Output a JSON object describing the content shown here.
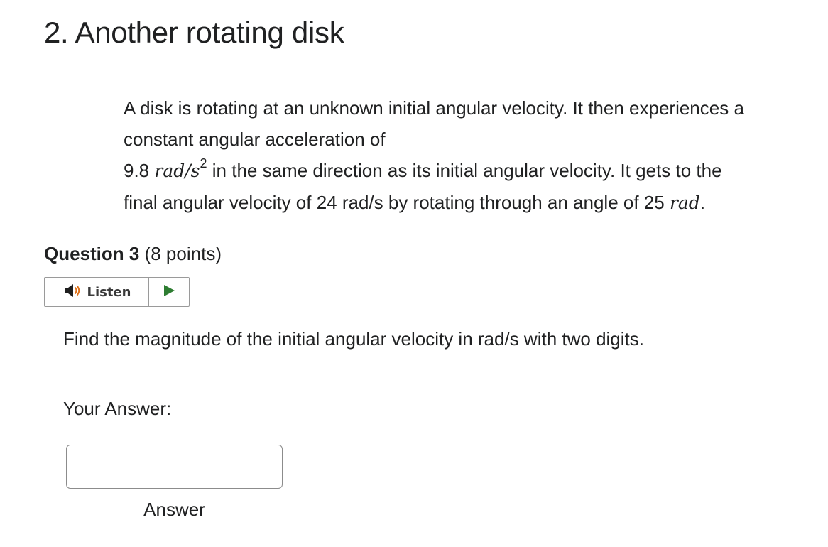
{
  "section": {
    "title": "2. Another rotating disk"
  },
  "problem": {
    "line1": "A disk is rotating at an unknown initial angular velocity. It then experiences a",
    "line2": "constant angular acceleration of",
    "line3_value": "9.8",
    "line3_unit": "rad/s",
    "line3_exponent": "2",
    "line3_rest": "in the same direction as its initial angular velocity. It gets to the",
    "line4_text": "final angular velocity of 24 rad/s by rotating through an angle of 25",
    "line4_unit": "rad",
    "line4_period": "."
  },
  "question": {
    "label": "Question 3",
    "points": "(8 points)",
    "listen_label": "Listen",
    "prompt": "Find the magnitude of the initial angular velocity in rad/s with two digits.",
    "answer_label": "Your Answer:",
    "answer_value": "",
    "answer_caption": "Answer"
  },
  "icons": {
    "speaker": "speaker-icon",
    "play": "play-icon"
  },
  "colors": {
    "text": "#202122",
    "play_green": "#2e7d32",
    "speaker_dark": "#1f1f1f",
    "speaker_waves": "#e0731c"
  }
}
